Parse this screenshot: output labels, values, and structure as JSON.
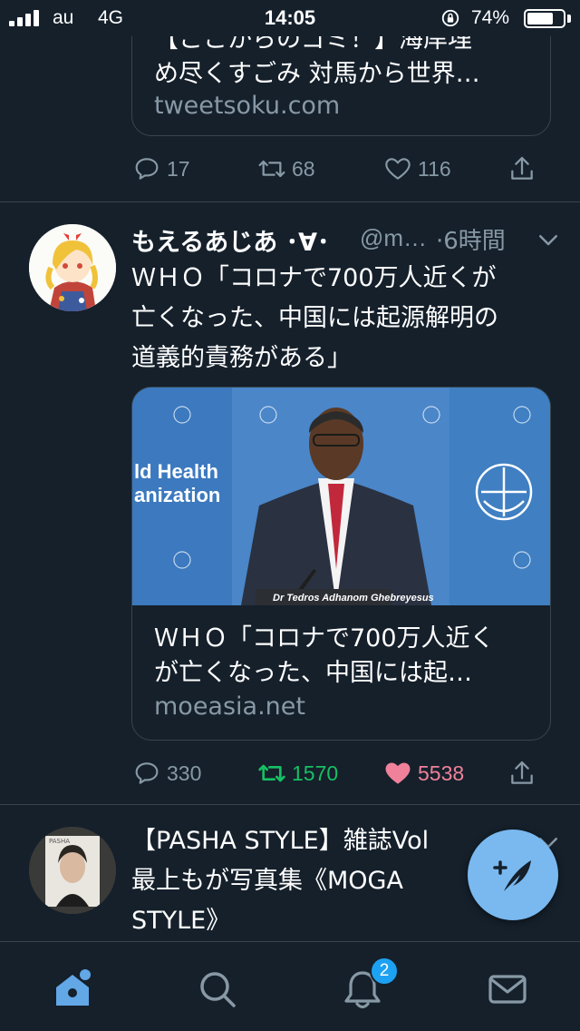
{
  "status_bar": {
    "carrier": "au",
    "network": "4G",
    "time": "14:05",
    "battery_percent": "74%",
    "battery_level": 0.74
  },
  "tweets": [
    {
      "card": {
        "title": "【ここからのゴミ！】海岸埋\nめ尽くすごみ 対馬から世界…",
        "domain": "tweetsoku.com"
      },
      "actions": {
        "replies": "17",
        "retweets": "68",
        "likes": "116",
        "retweeted": false,
        "liked": false
      }
    },
    {
      "author": {
        "name": "もえるあじあ ･∀･",
        "handle": "@m…",
        "time": "·6時間"
      },
      "text": "ＷＨＯ「コロナで700万人近くが\n亡くなった、中国には起源解明の\n道義的責務がある」",
      "image": {
        "caption": "Dr Tedros Adhanom Ghebreyesus",
        "backdrop_text": "ld Health\nanization"
      },
      "card": {
        "title": "ＷＨＯ「コロナで700万人近く\nが亡くなった、中国には起…",
        "domain": "moeasia.net"
      },
      "actions": {
        "replies": "330",
        "retweets": "1570",
        "likes": "5538",
        "retweeted": true,
        "liked": true
      }
    },
    {
      "text": "【PASHA STYLE】雑誌Vol\n最上もが写真集《MOGA\nSTYLE》"
    }
  ],
  "bottom_nav": {
    "notifications_badge": "2",
    "items": [
      "home-icon",
      "search-icon",
      "bell-icon",
      "mail-icon"
    ]
  },
  "colors": {
    "background": "#15202b",
    "divider": "#38444d",
    "muted": "#8899a6",
    "accent": "#1da1f2",
    "retweet": "#17bf63",
    "like": "#e0245e"
  }
}
